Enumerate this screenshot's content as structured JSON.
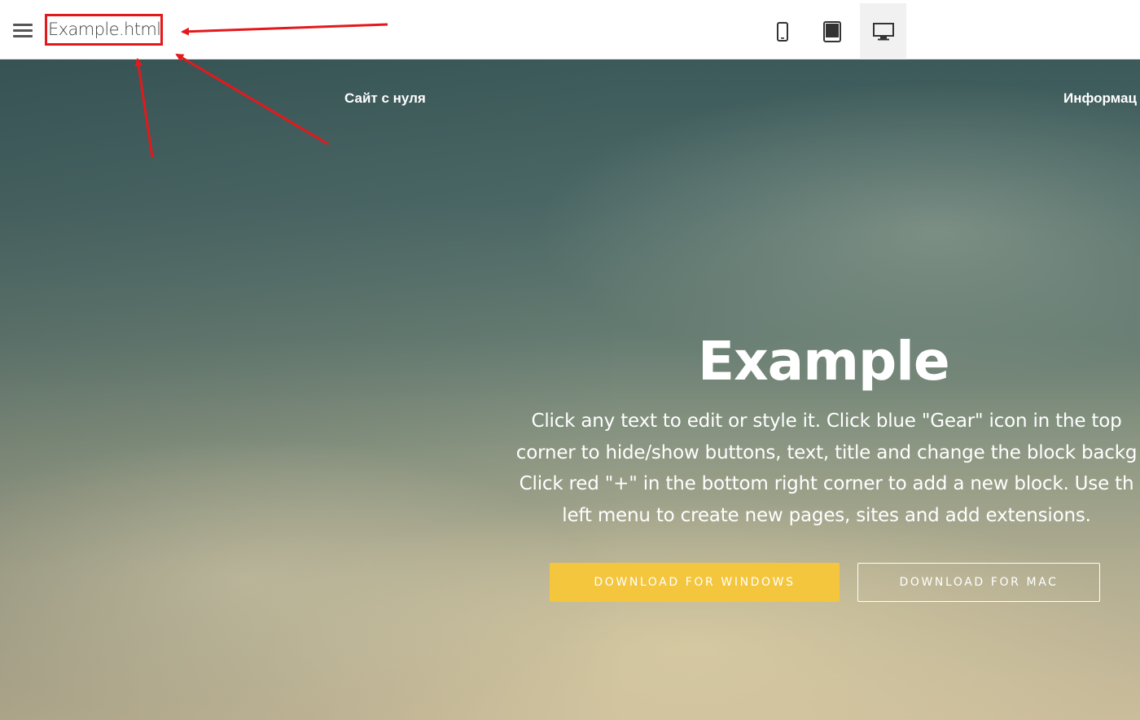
{
  "toolbar": {
    "filename": "Example.html",
    "menu_icon": "hamburger-icon",
    "devices": [
      {
        "name": "phone",
        "icon": "mobile-phone-icon",
        "active": false
      },
      {
        "name": "tablet",
        "icon": "tablet-icon",
        "active": false
      },
      {
        "name": "desktop",
        "icon": "desktop-monitor-icon",
        "active": true
      }
    ]
  },
  "hero": {
    "nav": [
      "Сайт с нуля",
      "Информац"
    ],
    "title": "Example",
    "text_lines": [
      "Click any text to edit or style it. Click blue \"Gear\" icon in the top",
      "corner to hide/show buttons, text, title and change the block backg",
      "Click red \"+\" in the bottom right corner to add a new block. Use th",
      "left menu to create new pages, sites and add extensions."
    ],
    "buttons": {
      "windows": "DOWNLOAD FOR WINDOWS",
      "mac": "DOWNLOAD FOR MAC"
    }
  },
  "colors": {
    "accent_button": "#f4c63d",
    "annotation_red": "#e3191c",
    "toolbar_active": "#f1f1f1"
  }
}
